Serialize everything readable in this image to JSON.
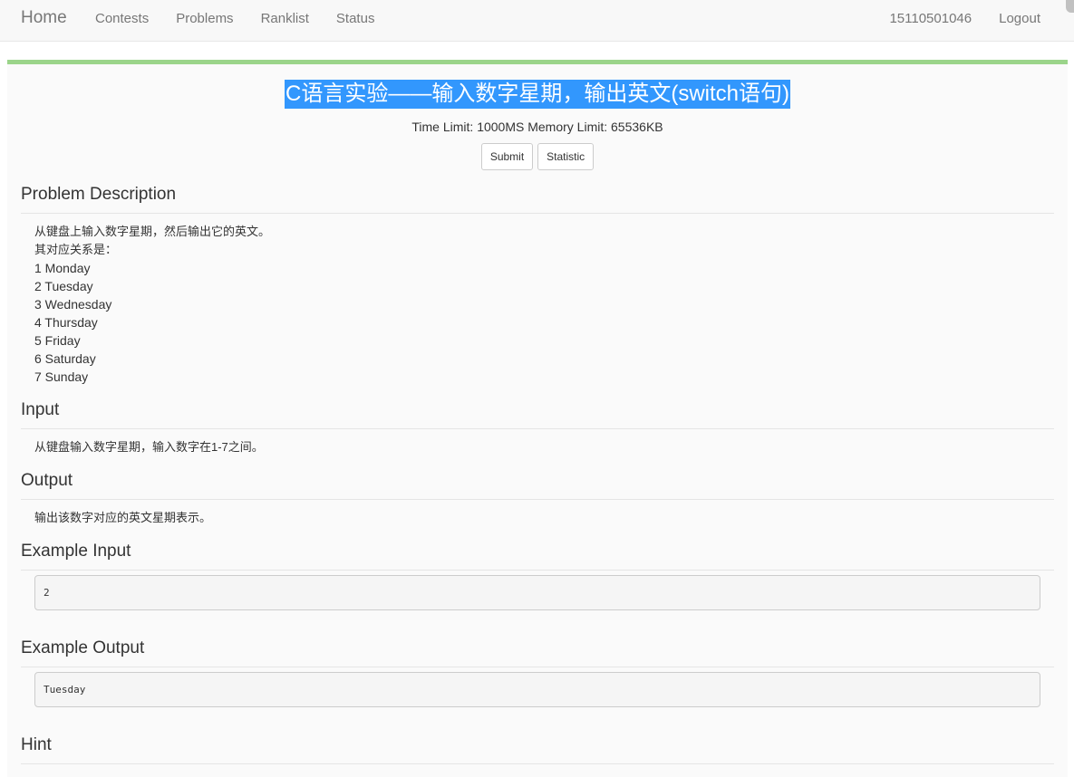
{
  "nav": {
    "brand": "Home",
    "left_items": [
      {
        "label": "Contests"
      },
      {
        "label": "Problems"
      },
      {
        "label": "Ranklist"
      },
      {
        "label": "Status"
      }
    ],
    "user": "15110501046",
    "logout": "Logout"
  },
  "problem": {
    "title": "C语言实验——输入数字星期，输出英文(switch语句)",
    "limits": "Time Limit: 1000MS Memory Limit: 65536KB",
    "buttons": {
      "submit": "Submit",
      "statistic": "Statistic"
    },
    "sections": {
      "description_title": "Problem Description",
      "description_lines": [
        "从键盘上输入数字星期，然后输出它的英文。",
        "其对应关系是：",
        "1 Monday",
        "2 Tuesday",
        "3 Wednesday",
        "4 Thursday",
        "5 Friday",
        "6 Saturday",
        "7 Sunday"
      ],
      "input_title": "Input",
      "input_text": "从键盘输入数字星期，输入数字在1-7之间。",
      "output_title": "Output",
      "output_text": "输出该数字对应的英文星期表示。",
      "example_input_title": "Example Input",
      "example_input": "2",
      "example_output_title": "Example Output",
      "example_output": "Tuesday",
      "hint_title": "Hint"
    }
  },
  "colors": {
    "accent_bar": "#9bd48a",
    "selection": "#3297fd"
  }
}
